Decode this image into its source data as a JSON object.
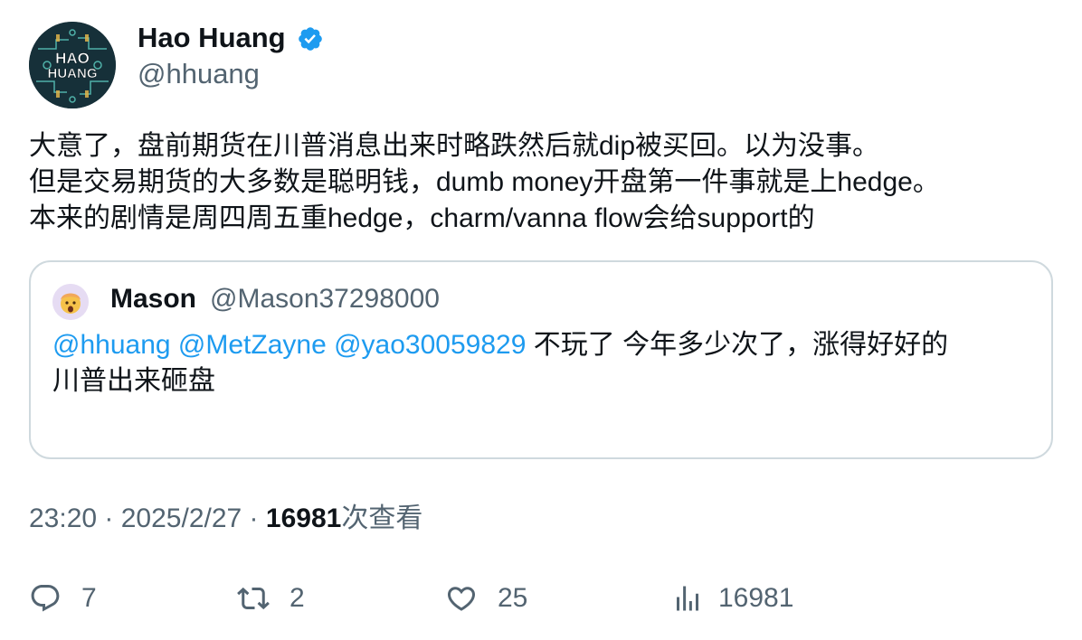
{
  "author": {
    "name": "Hao Huang",
    "handle": "@hhuang",
    "avatar_text": "HAO HUANG",
    "verified": true
  },
  "tweet": {
    "lines": [
      "大意了，盘前期货在川普消息出来时略跌然后就dip被买回。以为没事。",
      "但是交易期货的大多数是聪明钱，dumb money开盘第一件事就是上hedge。",
      "本来的剧情是周四周五重hedge，charm/vanna flow会给support的"
    ]
  },
  "quoted": {
    "name": "Mason",
    "handle": "@Mason37298000",
    "mentions": [
      "@hhuang",
      "@MetZayne",
      "@yao30059829"
    ],
    "text_line1": "不玩了 今年多少次了，涨得好好的",
    "text_line2": "川普出来砸盘"
  },
  "meta": {
    "time": "23:20",
    "date": "2025/2/27",
    "views": "16981",
    "views_label": "次查看"
  },
  "actions": {
    "replies": "7",
    "reposts": "2",
    "likes": "25",
    "views": "16981"
  },
  "colors": {
    "link": "#1d9bf0",
    "secondary_text": "#536471",
    "border": "#cfd9de",
    "verified": "#1d9bf0"
  },
  "icons": [
    "verified-badge-icon",
    "reply-icon",
    "repost-icon",
    "like-icon",
    "views-icon"
  ]
}
